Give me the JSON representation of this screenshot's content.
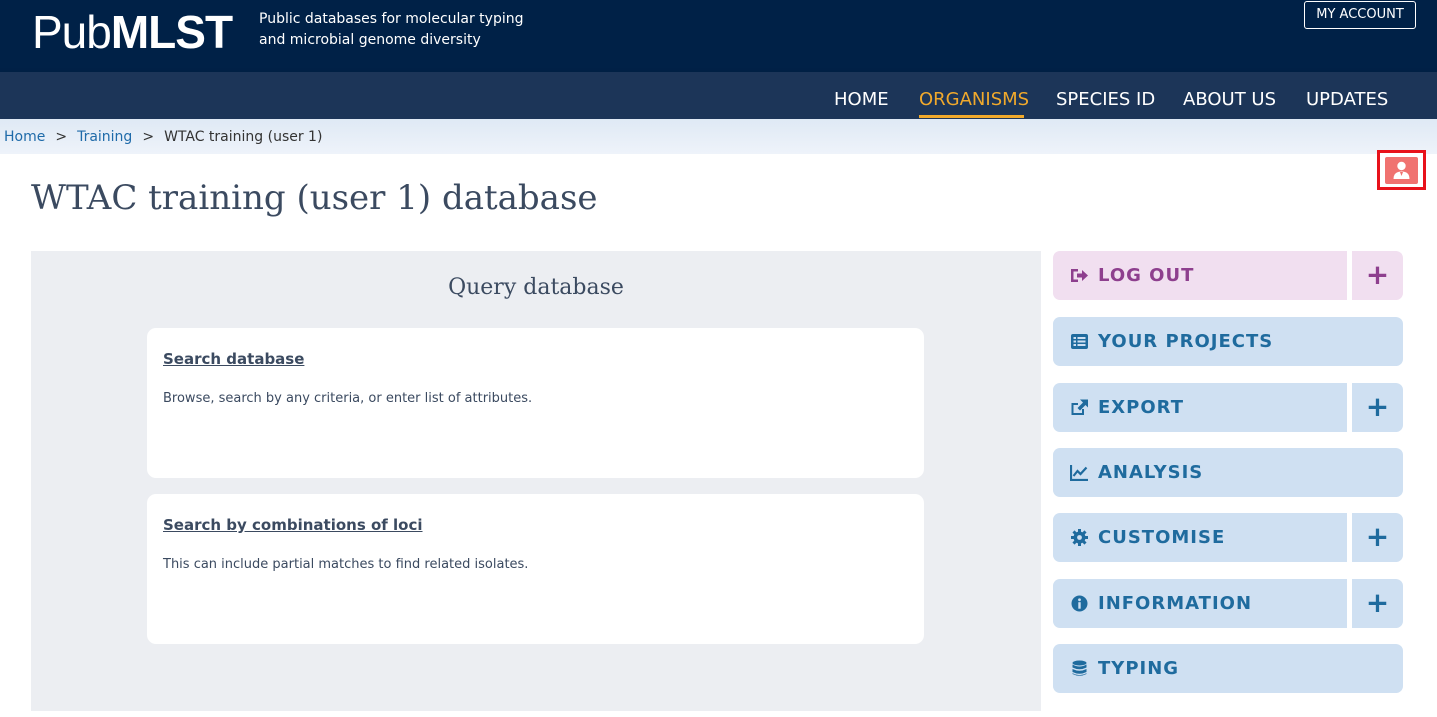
{
  "header": {
    "logo_pub": "Pub",
    "logo_mlst": "MLST",
    "tagline_line1": "Public databases for molecular typing",
    "tagline_line2": "and microbial genome diversity",
    "account_button": "MY ACCOUNT"
  },
  "nav": {
    "items": [
      "HOME",
      "ORGANISMS",
      "SPECIES ID",
      "ABOUT US",
      "UPDATES"
    ],
    "active": "ORGANISMS"
  },
  "breadcrumb": {
    "home": "Home",
    "training": "Training",
    "current": "WTAC training (user 1)",
    "separator": ">"
  },
  "page": {
    "title": "WTAC training (user 1) database"
  },
  "query": {
    "heading": "Query database",
    "cards": [
      {
        "title": "Search database",
        "description": "Browse, search by any criteria, or enter list of attributes."
      },
      {
        "title": "Search by combinations of loci",
        "description": "This can include partial matches to find related isolates."
      }
    ]
  },
  "menu": {
    "items": [
      {
        "label": "LOG OUT",
        "icon": "sign-out-icon",
        "expand": "+"
      },
      {
        "label": "YOUR PROJECTS",
        "icon": "list-icon"
      },
      {
        "label": "EXPORT",
        "icon": "external-link-icon",
        "expand": "+"
      },
      {
        "label": "ANALYSIS",
        "icon": "line-chart-icon"
      },
      {
        "label": "CUSTOMISE",
        "icon": "gear-icon",
        "expand": "+"
      },
      {
        "label": "INFORMATION",
        "icon": "info-circle-icon",
        "expand": "+"
      },
      {
        "label": "TYPING",
        "icon": "database-icon"
      }
    ]
  },
  "colors": {
    "header_bg": "#002147",
    "nav_bg": "#1c3558",
    "accent": "#f0a92c",
    "menu_blue": "#cfe0f2",
    "menu_text": "#1f6b9e",
    "logout_bg": "#f1dff0",
    "logout_text": "#8e3f8e"
  }
}
